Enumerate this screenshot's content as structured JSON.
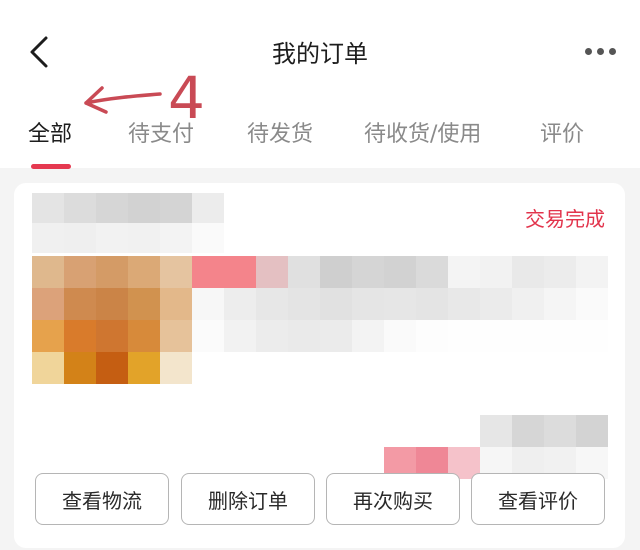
{
  "header": {
    "title": "我的订单",
    "back_icon": "chevron-left-icon",
    "more_icon": "more-horizontal-icon"
  },
  "tabs": [
    {
      "label": "全部",
      "active": true
    },
    {
      "label": "待支付",
      "active": false
    },
    {
      "label": "待发货",
      "active": false
    },
    {
      "label": "待收货/使用",
      "active": false
    },
    {
      "label": "评价",
      "active": false
    }
  ],
  "annotation": {
    "text": "4",
    "color": "#c94a55"
  },
  "order": {
    "status": "交易完成",
    "status_color": "#e2344c",
    "actions": [
      "查看物流",
      "删除订单",
      "再次购买",
      "查看评价"
    ]
  },
  "colors": {
    "accent": "#e53950",
    "background": "#f4f4f4"
  }
}
